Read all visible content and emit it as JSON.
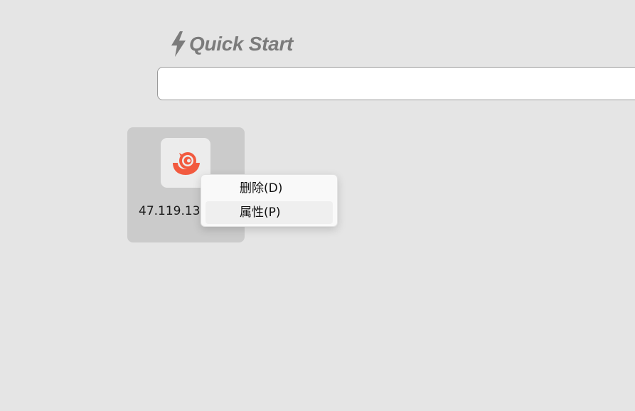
{
  "header": {
    "icon": "lightning-bolt-icon",
    "title": "Quick Start"
  },
  "search": {
    "value": "",
    "placeholder": ""
  },
  "tiles": [
    {
      "icon": "snail-logo-icon",
      "label": "47.119.13",
      "accent": "#f25a3f"
    }
  ],
  "context_menu": {
    "items": [
      {
        "label": "删除(D)"
      },
      {
        "label": "属性(P)"
      }
    ]
  },
  "colors": {
    "background": "#e5e5e5",
    "tile_bg": "#cbcbcb",
    "title": "#7b7b7b",
    "logo_accent": "#f25a3f"
  }
}
